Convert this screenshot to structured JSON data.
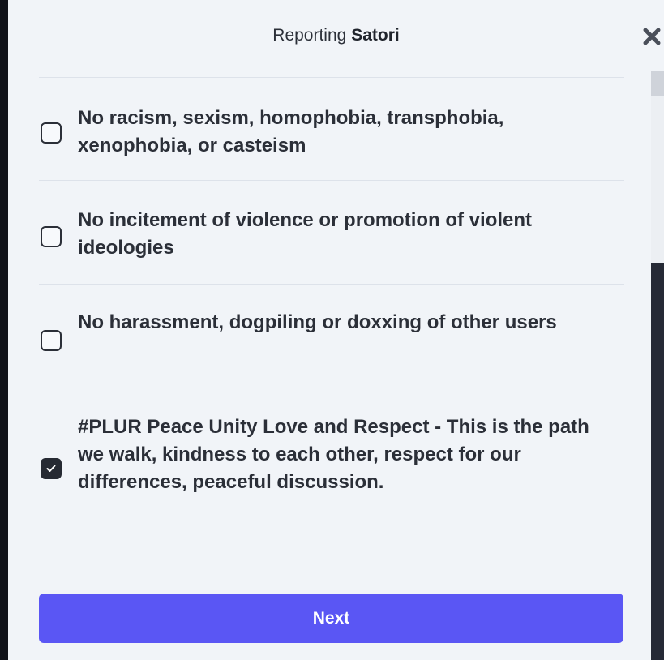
{
  "header": {
    "title_prefix": "Reporting",
    "title_name": "Satori"
  },
  "rules": [
    {
      "label": "No racism, sexism, homophobia, transphobia, xenophobia, or casteism",
      "checked": false
    },
    {
      "label": "No incitement of violence or promotion of violent ideologies",
      "checked": false
    },
    {
      "label": "No harassment, dogpiling or doxxing of other users",
      "checked": false
    },
    {
      "label": "#PLUR Peace Unity Love and Respect - This is the path we walk, kindness to each other, respect for our differences, peaceful discussion.",
      "checked": true
    }
  ],
  "footer": {
    "next_label": "Next"
  },
  "colors": {
    "accent": "#5a56f4",
    "modal_bg": "#f1f4f8",
    "text": "#2b2f38"
  },
  "icons": {
    "close": "close-icon",
    "check": "checkmark-icon"
  }
}
